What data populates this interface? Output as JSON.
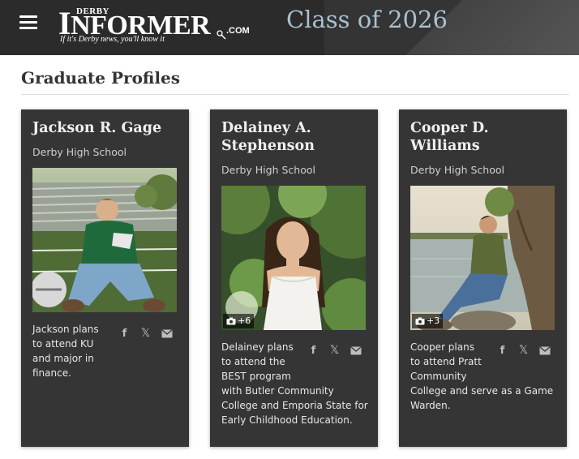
{
  "header": {
    "logo": {
      "derby": "DERBY",
      "informer_cap": "I",
      "informer_rest": "NFORMER",
      "dotcom": ".COM",
      "tagline": "If it's Derby news, you'll know it"
    },
    "title": "Class of 2026",
    "menu_icon": "hamburger-menu-icon"
  },
  "section": {
    "title": "Graduate Profiles"
  },
  "profiles": [
    {
      "name": "Jackson R. Gage",
      "school": "Derby High School",
      "photo_count": "",
      "description": [
        "Jackson plans",
        "to attend KU",
        "and major in",
        "finance."
      ]
    },
    {
      "name": "Delainey A. Stephenson",
      "school": "Derby High School",
      "photo_count": "+6",
      "description": [
        "Delainey plans",
        "to attend the",
        "BEST program",
        "with Butler Community",
        "College and Emporia State for",
        "Early Childhood Education."
      ]
    },
    {
      "name": "Cooper D. Williams",
      "school": "Derby High School",
      "photo_count": "+3",
      "description": [
        "Cooper plans",
        "to attend Pratt",
        "Community",
        "College and serve as a Game",
        "Warden."
      ]
    }
  ],
  "share_icons": [
    "facebook-icon",
    "x-icon",
    "email-icon"
  ],
  "colors": {
    "header_bg": "#2b2b2b",
    "card_bg": "#363535",
    "title_accent": "#a9c1cf"
  }
}
